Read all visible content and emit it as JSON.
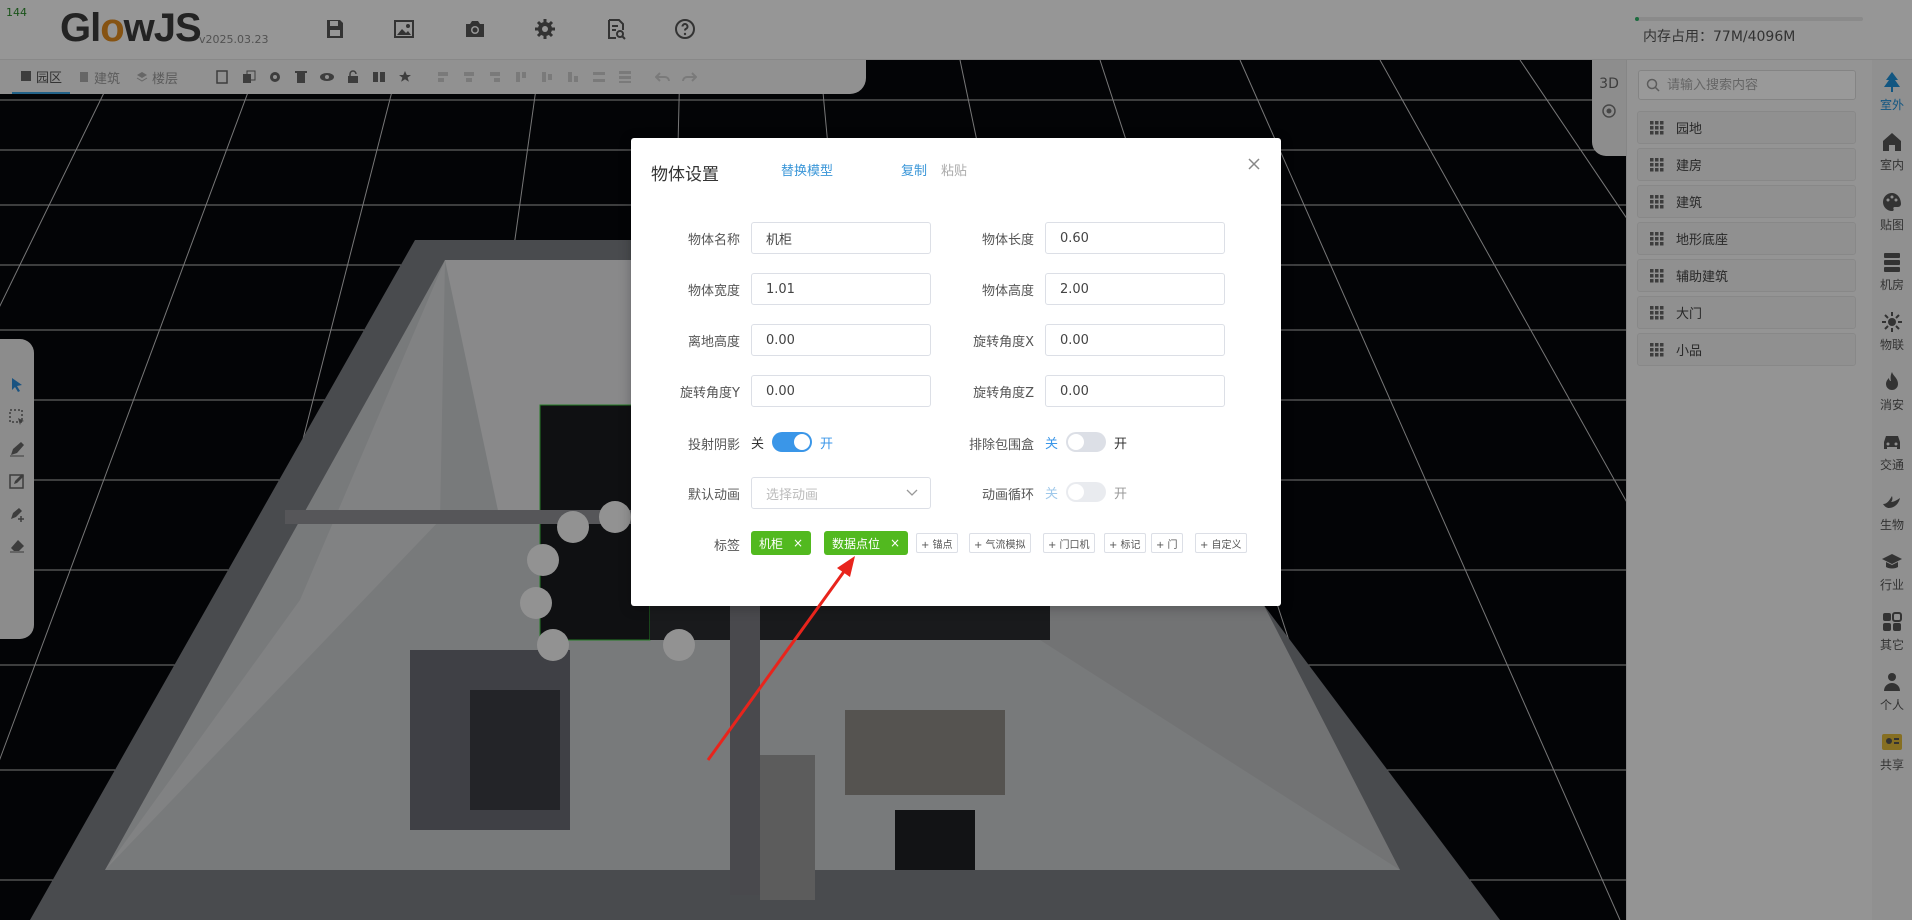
{
  "fps": "144",
  "app": {
    "logo_prefix": "Gl",
    "logo_o": "o",
    "logo_suffix": "wJS",
    "version": "v2025.03.23"
  },
  "memory": {
    "text": "内存占用：77M/4096M",
    "used_fraction": 0.019
  },
  "top_icons": [
    "save-icon",
    "image-icon",
    "camera-icon",
    "settings-icon",
    "document-search-icon",
    "help-icon"
  ],
  "subtoolbar": {
    "tabs": [
      {
        "label": "园区",
        "active": true
      },
      {
        "label": "建筑",
        "active": false
      },
      {
        "label": "楼层",
        "active": false
      }
    ]
  },
  "view3d": {
    "label": "3D"
  },
  "search": {
    "placeholder": "请输入搜索内容"
  },
  "categories": [
    "园地",
    "建房",
    "建筑",
    "地形底座",
    "辅助建筑",
    "大门",
    "小品"
  ],
  "nav": [
    {
      "label": "室外",
      "icon": "tree-icon",
      "active": true
    },
    {
      "label": "室内",
      "icon": "home-icon",
      "active": false
    },
    {
      "label": "贴图",
      "icon": "palette-icon",
      "active": false
    },
    {
      "label": "机房",
      "icon": "server-icon",
      "active": false
    },
    {
      "label": "物联",
      "icon": "iot-icon",
      "active": false
    },
    {
      "label": "消安",
      "icon": "fire-icon",
      "active": false
    },
    {
      "label": "交通",
      "icon": "car-icon",
      "active": false
    },
    {
      "label": "生物",
      "icon": "bird-icon",
      "active": false
    },
    {
      "label": "行业",
      "icon": "graduation-cap-icon",
      "active": false
    },
    {
      "label": "其它",
      "icon": "apps-icon",
      "active": false
    },
    {
      "label": "个人",
      "icon": "user-icon",
      "active": false
    },
    {
      "label": "共享",
      "icon": "share-icon",
      "active": false
    }
  ],
  "modal": {
    "title": "物体设置",
    "replace_model": "替换模型",
    "copy": "复制",
    "paste": "粘贴",
    "fields": {
      "name_label": "物体名称",
      "name_value": "机柜",
      "length_label": "物体长度",
      "length_value": "0.60",
      "width_label": "物体宽度",
      "width_value": "1.01",
      "height_label": "物体高度",
      "height_value": "2.00",
      "ground_label": "离地高度",
      "ground_value": "0.00",
      "rotx_label": "旋转角度X",
      "rotx_value": "0.00",
      "roty_label": "旋转角度Y",
      "roty_value": "0.00",
      "rotz_label": "旋转角度Z",
      "rotz_value": "0.00"
    },
    "shadow": {
      "label": "投射阴影",
      "off": "关",
      "on": "开",
      "state": true
    },
    "bbox": {
      "label": "排除包围盒",
      "off": "关",
      "on": "开",
      "state": false
    },
    "anim": {
      "label": "默认动画",
      "placeholder": "选择动画"
    },
    "anim_loop": {
      "label": "动画循环",
      "off": "关",
      "on": "开",
      "state": false
    },
    "tags_label": "标签",
    "tags": [
      "机柜",
      "数据点位"
    ],
    "tag_close": "×",
    "add_tags": [
      "+ 锚点",
      "+ 气流模拟",
      "+ 门口机",
      "+ 标记",
      "+ 门",
      "+ 自定义"
    ]
  },
  "colors": {
    "accent": "#3a96e8",
    "tag_green": "#52b91f",
    "annotation": "#e8241c"
  }
}
